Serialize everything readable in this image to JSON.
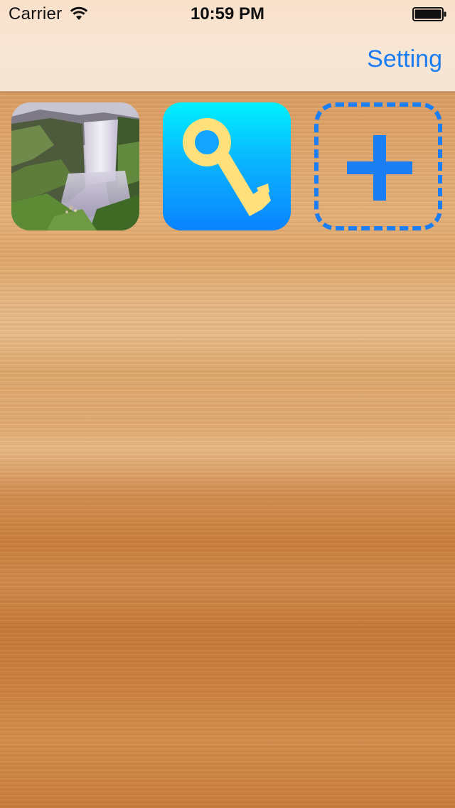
{
  "status_bar": {
    "carrier": "Carrier",
    "time": "10:59 PM",
    "icons": [
      "wifi-icon",
      "battery-icon"
    ]
  },
  "nav_bar": {
    "setting_label": "Setting",
    "accent_color": "#1a7cf2"
  },
  "tiles": [
    {
      "name": "waterfall-photo",
      "icon": "waterfall-image"
    },
    {
      "name": "key-app",
      "icon": "key-icon",
      "colors": [
        "#00f1ff",
        "#0a83ff"
      ],
      "key_color": "#ffe07a"
    },
    {
      "name": "add-item",
      "icon": "plus-icon",
      "color": "#1b7ef3"
    }
  ]
}
